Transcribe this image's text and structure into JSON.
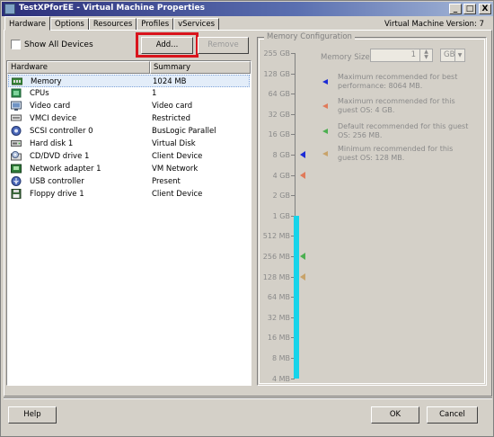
{
  "window": {
    "title": "TestXPforEE - Virtual Machine Properties",
    "version_label": "Virtual Machine Version: 7",
    "controls": {
      "minimize": "_",
      "maximize": "□",
      "close": "X"
    }
  },
  "tabs": [
    {
      "label": "Hardware",
      "active": true
    },
    {
      "label": "Options",
      "active": false
    },
    {
      "label": "Resources",
      "active": false
    },
    {
      "label": "Profiles",
      "active": false
    },
    {
      "label": "vServices",
      "active": false
    }
  ],
  "hardware_panel": {
    "show_all_devices_label": "Show All Devices",
    "show_all_devices_checked": false,
    "add_button": "Add...",
    "remove_button": "Remove",
    "columns": [
      "Hardware",
      "Summary"
    ],
    "rows": [
      {
        "name": "Memory",
        "summary": "1024 MB",
        "icon": "memory-icon",
        "selected": true
      },
      {
        "name": "CPUs",
        "summary": "1",
        "icon": "cpu-icon",
        "selected": false
      },
      {
        "name": "Video card",
        "summary": "Video card",
        "icon": "video-card-icon",
        "selected": false
      },
      {
        "name": "VMCI device",
        "summary": "Restricted",
        "icon": "vmci-device-icon",
        "selected": false
      },
      {
        "name": "SCSI controller 0",
        "summary": "BusLogic Parallel",
        "icon": "scsi-controller-icon",
        "selected": false
      },
      {
        "name": "Hard disk 1",
        "summary": "Virtual Disk",
        "icon": "hard-disk-icon",
        "selected": false
      },
      {
        "name": "CD/DVD drive 1",
        "summary": "Client Device",
        "icon": "cd-dvd-drive-icon",
        "selected": false
      },
      {
        "name": "Network adapter 1",
        "summary": "VM Network",
        "icon": "network-adapter-icon",
        "selected": false
      },
      {
        "name": "USB controller",
        "summary": "Present",
        "icon": "usb-controller-icon",
        "selected": false
      },
      {
        "name": "Floppy drive 1",
        "summary": "Client Device",
        "icon": "floppy-drive-icon",
        "selected": false
      }
    ]
  },
  "memory_config": {
    "title": "Memory Configuration",
    "size_label": "Memory Size:",
    "size_value": "1",
    "unit": "GB",
    "scale_labels": [
      "255 GB",
      "128 GB",
      "64 GB",
      "32 GB",
      "16 GB",
      "8 GB",
      "4 GB",
      "2 GB",
      "1 GB",
      "512 MB",
      "256 MB",
      "128 MB",
      "64 MB",
      "32 MB",
      "16 MB",
      "8 MB",
      "4 MB"
    ],
    "current_level": "1 GB",
    "legend": [
      {
        "text": "Maximum recommended for best performance: 8064 MB.",
        "color": "#1b2bd6",
        "level": "8 GB"
      },
      {
        "text": "Maximum recommended for this guest OS: 4 GB.",
        "color": "#e07a5a",
        "level": "4 GB"
      },
      {
        "text": "Default recommended for this guest OS: 256 MB.",
        "color": "#4caf50",
        "level": "256 MB"
      },
      {
        "text": "Minimum recommended for this guest OS: 128 MB.",
        "color": "#c8a36a",
        "level": "128 MB"
      }
    ]
  },
  "footer": {
    "help_button": "Help",
    "ok_button": "OK",
    "cancel_button": "Cancel"
  }
}
